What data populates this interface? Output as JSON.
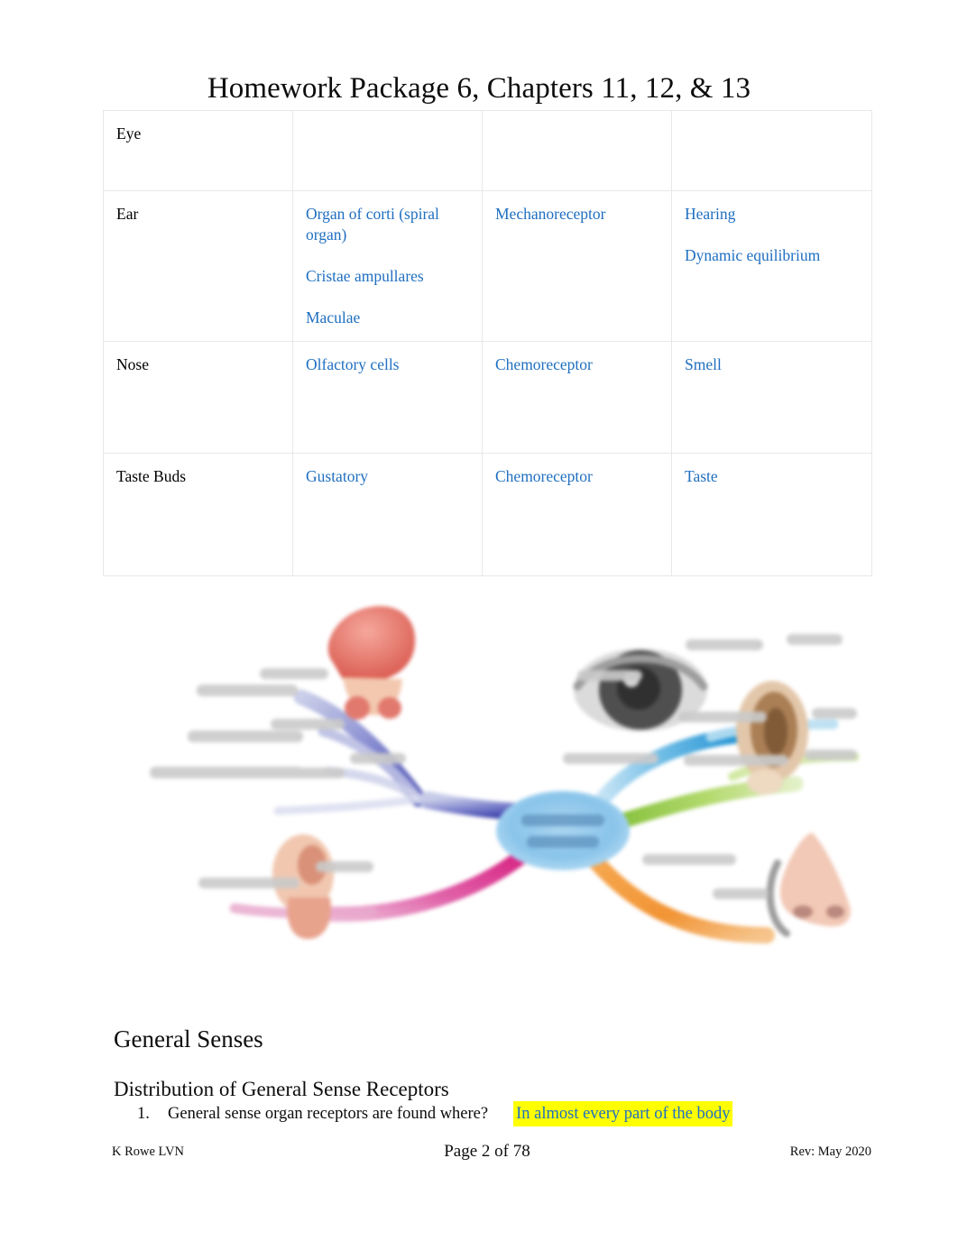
{
  "document": {
    "title": "Homework Package 6, Chapters 11, 12, & 13"
  },
  "table": {
    "name": "special-senses-table",
    "rows": [
      {
        "organ": "Eye",
        "receptor": "",
        "receptor_type": "",
        "sense": "",
        "sense_line2": ""
      },
      {
        "organ": "Ear",
        "receptor": "Organ of corti (spiral organ)",
        "receptor_2": "Cristae ampullares",
        "receptor_3": "Maculae",
        "receptor_type": "Mechanoreceptor",
        "sense": "Hearing",
        "sense_line2": "Dynamic equilibrium"
      },
      {
        "organ": "Nose",
        "receptor": "Olfactory cells",
        "receptor_type": "Chemoreceptor",
        "sense": "Smell",
        "sense_line2": ""
      },
      {
        "organ": "Taste Buds",
        "receptor": "Gustatory",
        "receptor_type": "Chemoreceptor",
        "sense": "Taste",
        "sense_line2": ""
      }
    ]
  },
  "figure": {
    "name": "five-senses-mind-map",
    "alt": "Blurred mind map diagram of the five senses radiating from a central blue ellipse",
    "center_label": "FIVE SENSES",
    "branches": [
      {
        "name": "touch",
        "color": "#4a4fb5",
        "icon": "hand-icon"
      },
      {
        "name": "sight",
        "color": "#2f9ddb",
        "icon": "eye-icon"
      },
      {
        "name": "hearing",
        "color": "#8dc63f",
        "icon": "ear-icon"
      },
      {
        "name": "smell",
        "color": "#f28c28",
        "icon": "nose-icon"
      },
      {
        "name": "taste",
        "color": "#d6197d",
        "icon": "tongue-icon"
      }
    ]
  },
  "headings": {
    "general_senses": "General Senses",
    "distribution": "Distribution of General Sense Receptors"
  },
  "question": {
    "number": "1.",
    "prompt": "General sense organ receptors are found where?",
    "answer": "In almost every part of the body"
  },
  "footer": {
    "left": "K Rowe LVN",
    "center": "Page 2 of 78",
    "right": "Rev: May 2020"
  },
  "colors": {
    "answer_text": "#1f6fc0",
    "highlight": "#ffff00",
    "table_border": "#e8e8e8"
  }
}
